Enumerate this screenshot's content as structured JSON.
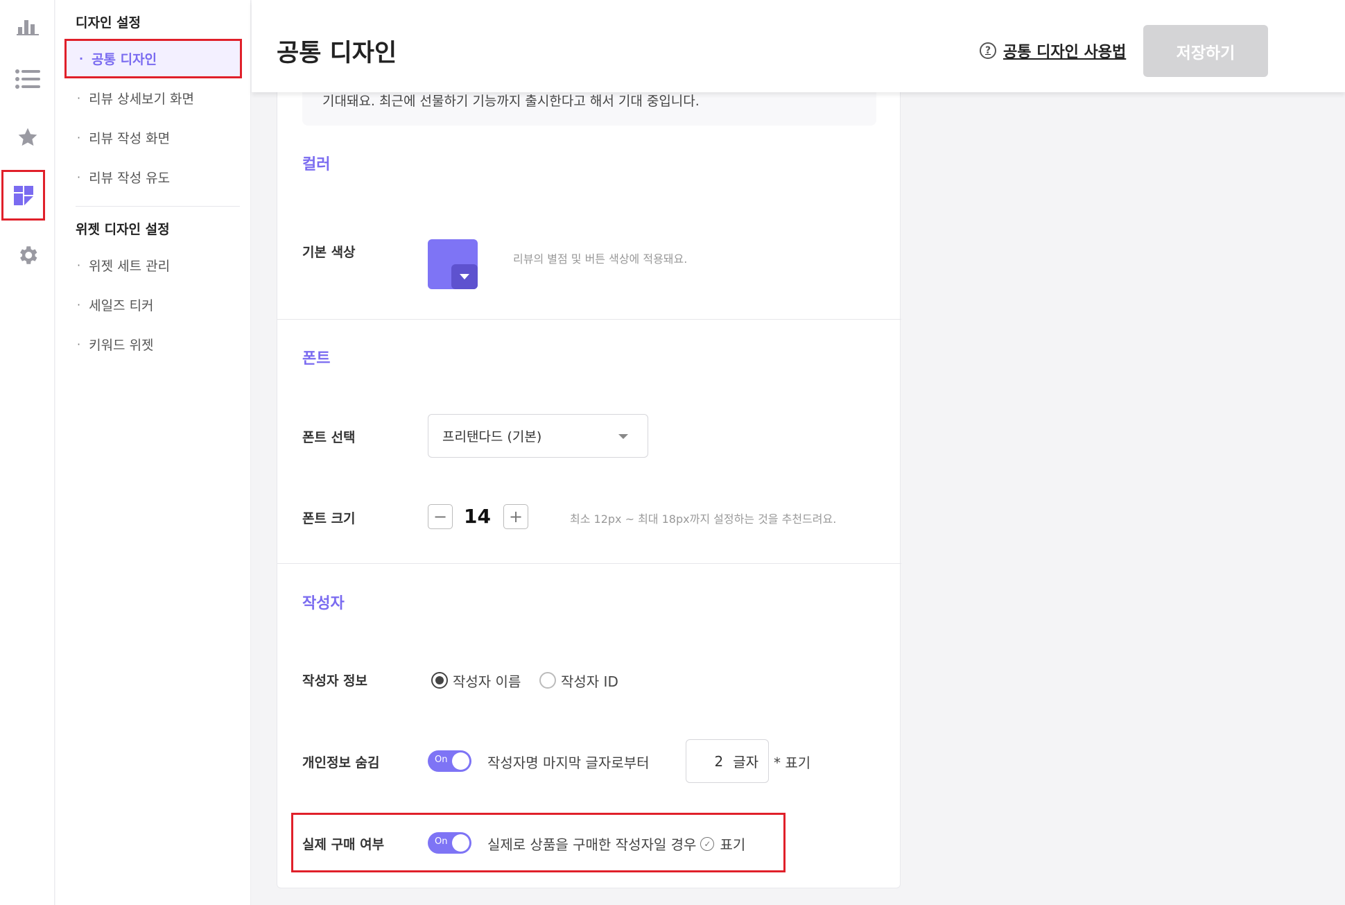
{
  "rail": {
    "icons": [
      "bar-chart-icon",
      "list-icon",
      "star-icon",
      "widget-grid-icon",
      "gear-icon"
    ],
    "accent": "#7a6bf0"
  },
  "sidebar": {
    "design_group_title": "디자인 설정",
    "design_items": [
      "공통 디자인",
      "리뷰 상세보기 화면",
      "리뷰 작성 화면",
      "리뷰 작성 유도"
    ],
    "widget_group_title": "위젯 디자인 설정",
    "widget_items": [
      "위젯 세트 관리",
      "세일즈 티커",
      "키워드 위젯"
    ]
  },
  "header": {
    "title": "공통 디자인",
    "help_link": "공통 디자인 사용법",
    "save_label": "저장하기"
  },
  "content": {
    "quote_text": "기대돼요. 최근에 선물하기 기능까지 출시한다고 해서 기대 중입니다.",
    "color_section": {
      "title": "컬러",
      "base_color_label": "기본 색상",
      "base_color_value": "#7e74f5",
      "base_color_hint": "리뷰의 별점 및 버튼 색상에 적용돼요."
    },
    "font_section": {
      "title": "폰트",
      "font_select_label": "폰트 선택",
      "font_selected": "프리탠다드 (기본)",
      "font_size_label": "폰트 크기",
      "font_size_value": "14",
      "minus": "−",
      "plus": "+",
      "font_size_hint": "최소 12px ~ 최대 18px까지 설정하는 것을 추천드려요."
    },
    "author_section": {
      "title": "작성자",
      "info_label": "작성자 정보",
      "radio_name": "작성자 이름",
      "radio_id": "작성자 ID",
      "privacy_label": "개인정보 숨김",
      "toggle_on": "On",
      "privacy_text": "작성자명 마지막 글자로부터",
      "privacy_count": "2",
      "privacy_unit": "글자",
      "privacy_suffix": "* 표기",
      "purchase_label": "실제 구매 여부",
      "purchase_text": "실제로 상품을 구매한 작성자일 경우",
      "purchase_suffix": "표기"
    }
  }
}
